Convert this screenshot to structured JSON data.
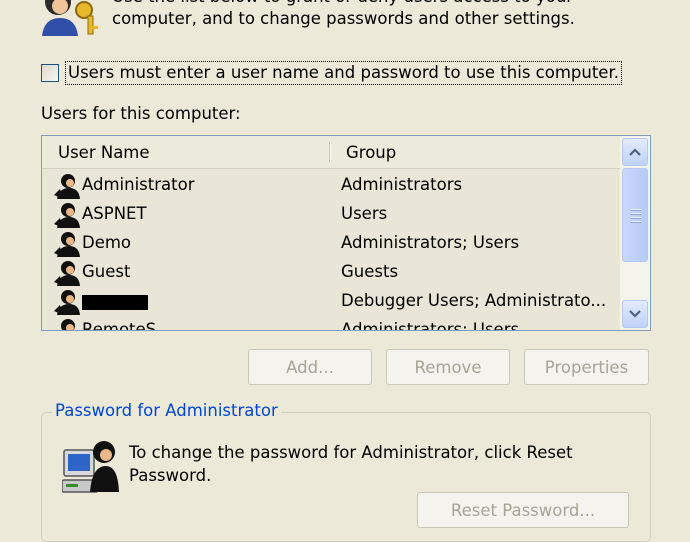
{
  "intro": {
    "line1": "Use the list below to grant or deny users access to your",
    "line2": "computer, and to change passwords and other settings."
  },
  "checkbox": {
    "label": "Users must enter a user name and password to use this computer.",
    "checked": false
  },
  "users_label": "Users for this computer:",
  "table": {
    "columns": [
      "User Name",
      "Group"
    ],
    "rows": [
      {
        "name": "Administrator",
        "group": "Administrators"
      },
      {
        "name": "ASPNET",
        "group": "Users"
      },
      {
        "name": "Demo",
        "group": "Administrators; Users"
      },
      {
        "name": "Guest",
        "group": "Guests"
      },
      {
        "name": "",
        "group": "Debugger Users; Administrato..."
      },
      {
        "name": "RemoteS...",
        "group": "Administrators; Users"
      }
    ]
  },
  "buttons": {
    "add": "Add...",
    "remove": "Remove",
    "properties": "Properties"
  },
  "password_group": {
    "title": "Password for Administrator",
    "text_line1": "To change the password for Administrator, click Reset",
    "text_line2": "Password.",
    "reset_button": "Reset Password..."
  },
  "colors": {
    "accent": "#0046D5",
    "background": "#ECE9D8",
    "list_bg": "#E9E5D7"
  }
}
